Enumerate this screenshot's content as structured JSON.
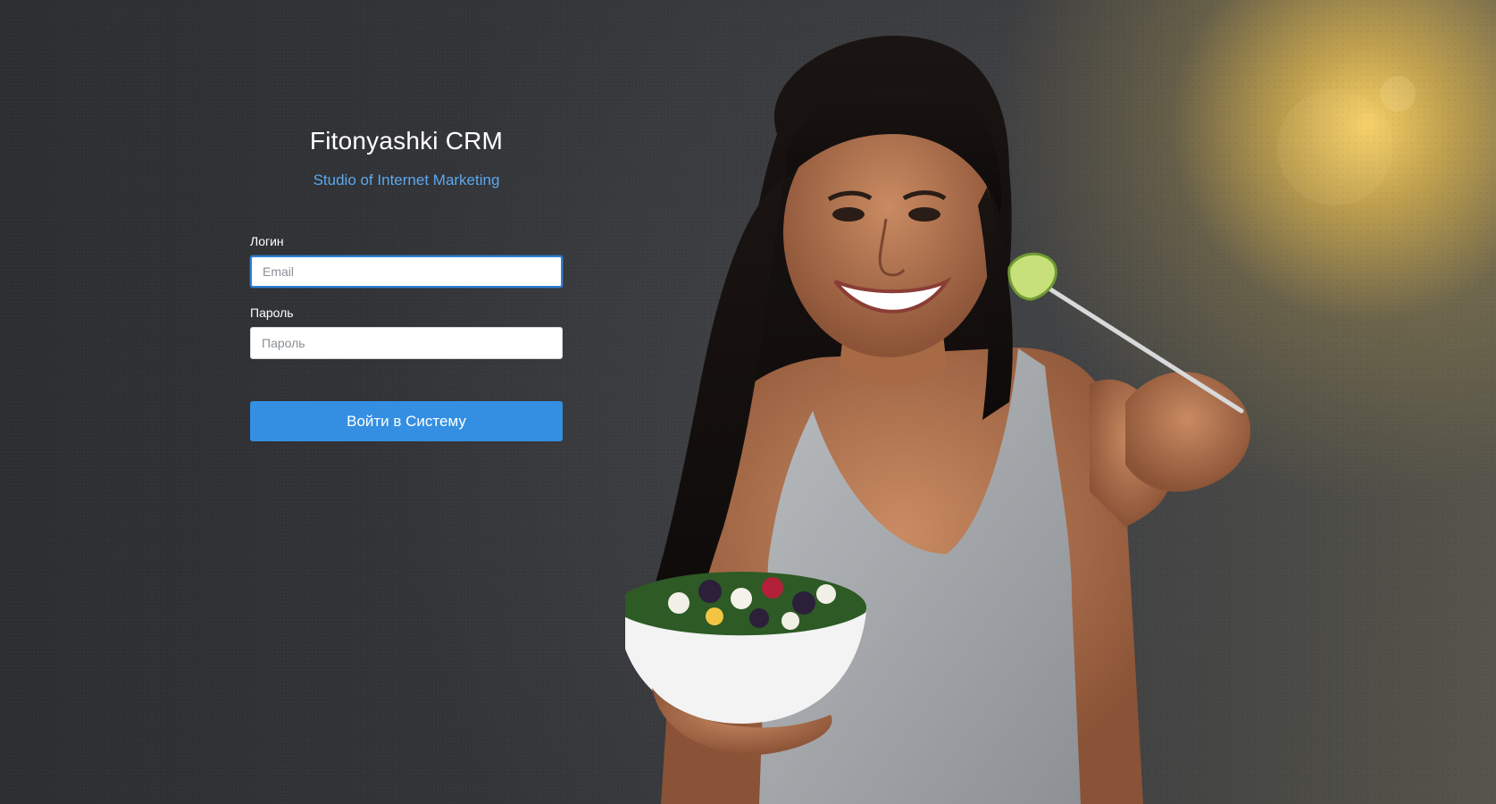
{
  "brand": {
    "title": "Fitonyashki CRM",
    "subtitle": "Studio of Internet Marketing"
  },
  "login_form": {
    "login_label": "Логин",
    "login_placeholder": "Email",
    "login_value": "",
    "password_label": "Пароль",
    "password_placeholder": "Пароль",
    "password_value": "",
    "submit_label": "Войти в Систему"
  },
  "colors": {
    "accent": "#348fe2",
    "subtitle": "#5da8ee",
    "background": "#34363a"
  },
  "background_image": {
    "subject": "woman-holding-salad-bowl-and-fork"
  }
}
